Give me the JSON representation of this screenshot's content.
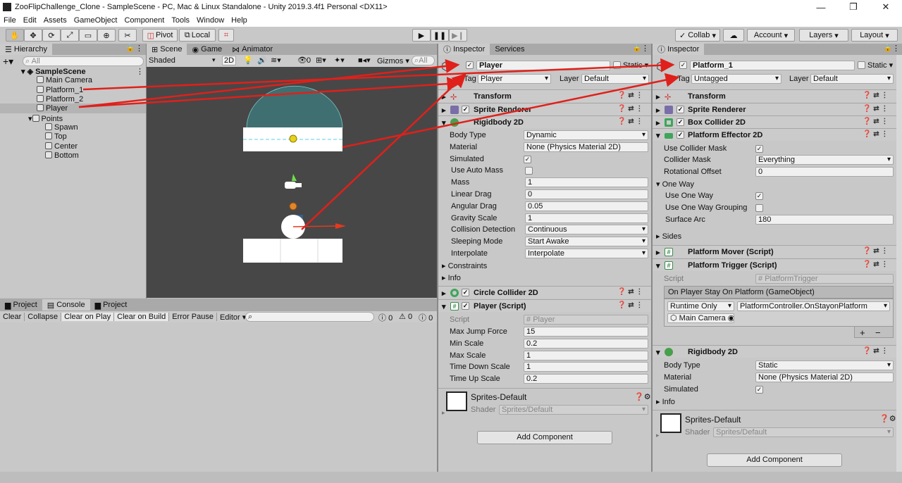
{
  "window": {
    "title": "ZooFlipChallenge_Clone - SampleScene - PC, Mac & Linux Standalone - Unity 2019.3.4f1 Personal <DX11>"
  },
  "menu": [
    "File",
    "Edit",
    "Assets",
    "GameObject",
    "Component",
    "Tools",
    "Window",
    "Help"
  ],
  "toolbar": {
    "pivot": "Pivot",
    "local": "Local",
    "collab": "Collab",
    "account": "Account",
    "layers": "Layers",
    "layout": "Layout"
  },
  "hierarchy": {
    "tab": "Hierarchy",
    "search_placeholder": "All",
    "items": [
      {
        "label": "SampleScene"
      },
      {
        "label": "Main Camera"
      },
      {
        "label": "Platform_1"
      },
      {
        "label": "Platform_2"
      },
      {
        "label": "Player"
      },
      {
        "label": "Points"
      },
      {
        "label": "Spawn"
      },
      {
        "label": "Top"
      },
      {
        "label": "Center"
      },
      {
        "label": "Bottom"
      }
    ]
  },
  "scene": {
    "tabs": [
      "Scene",
      "Game",
      "Animator"
    ],
    "shading": "Shaded",
    "mode_2d": "2D",
    "fx_count": "0",
    "gizmos": "Gizmos",
    "search_placeholder": "All"
  },
  "console": {
    "tabs": [
      "Project",
      "Console",
      "Project"
    ],
    "buttons": [
      "Clear",
      "Collapse",
      "Clear on Play",
      "Clear on Build",
      "Error Pause",
      "Editor"
    ],
    "counts": [
      "0",
      "0",
      "0"
    ]
  },
  "inspector1": {
    "tabs": [
      "Inspector",
      "Services"
    ],
    "name": "Player",
    "static": "Static",
    "tag_label": "Tag",
    "tag": "Player",
    "layer_label": "Layer",
    "layer": "Default",
    "components": {
      "transform": "Transform",
      "sprite_renderer": "Sprite Renderer",
      "rigidbody": "Rigidbody 2D",
      "circle": "Circle Collider 2D",
      "player_script": "Player (Script)"
    },
    "rb": {
      "body_type_label": "Body Type",
      "body_type": "Dynamic",
      "material_label": "Material",
      "material": "None (Physics Material 2D)",
      "simulated_label": "Simulated",
      "auto_mass_label": "Use Auto Mass",
      "mass_label": "Mass",
      "mass": "1",
      "linear_label": "Linear Drag",
      "linear": "0",
      "angular_label": "Angular Drag",
      "angular": "0.05",
      "gravity_label": "Gravity Scale",
      "gravity": "1",
      "collision_label": "Collision Detection",
      "collision": "Continuous",
      "sleeping_label": "Sleeping Mode",
      "sleeping": "Start Awake",
      "interpolate_label": "Interpolate",
      "interpolate": "Interpolate",
      "constraints": "Constraints",
      "info": "Info"
    },
    "script": {
      "script_label": "Script",
      "script": "Player",
      "jump_label": "Max Jump Force",
      "jump": "15",
      "min_label": "Min Scale",
      "min": "0.2",
      "max_label": "Max Scale",
      "max": "1",
      "down_label": "Time Down Scale",
      "down": "1",
      "up_label": "Time Up Scale",
      "up": "0.2"
    },
    "material": {
      "name": "Sprites-Default",
      "shader_label": "Shader",
      "shader": "Sprites/Default"
    },
    "add_component": "Add Component"
  },
  "inspector2": {
    "tab": "Inspector",
    "name": "Platform_1",
    "static": "Static",
    "tag_label": "Tag",
    "tag": "Untagged",
    "layer_label": "Layer",
    "layer": "Default",
    "components": {
      "transform": "Transform",
      "sprite_renderer": "Sprite Renderer",
      "box": "Box Collider 2D",
      "effector": "Platform Effector 2D",
      "mover": "Platform Mover (Script)",
      "trigger": "Platform Trigger (Script)",
      "rigidbody": "Rigidbody 2D"
    },
    "effector": {
      "use_mask_label": "Use Collider Mask",
      "mask_label": "Collider Mask",
      "mask": "Everything",
      "offset_label": "Rotational Offset",
      "offset": "0",
      "one_way": "One Way",
      "use_one_way_label": "Use One Way",
      "grouping_label": "Use One Way Grouping",
      "arc_label": "Surface Arc",
      "arc": "180",
      "sides": "Sides"
    },
    "trigger": {
      "script_label": "Script",
      "script": "PlatformTrigger",
      "event_title": "On Player Stay On Platform (GameObject)",
      "runtime": "Runtime Only",
      "function": "PlatformController.OnStayonPlatform",
      "target": "Main Camera",
      "plus": "+",
      "minus": "−"
    },
    "rb": {
      "body_type_label": "Body Type",
      "body_type": "Static",
      "material_label": "Material",
      "material": "None (Physics Material 2D)",
      "simulated_label": "Simulated",
      "info": "Info"
    },
    "material": {
      "name": "Sprites-Default",
      "shader_label": "Shader",
      "shader": "Sprites/Default"
    },
    "add_component": "Add Component"
  },
  "colors": {
    "scene_bg": "#474747",
    "annotation": "#e0201a",
    "panel": "#c8c8c8"
  }
}
